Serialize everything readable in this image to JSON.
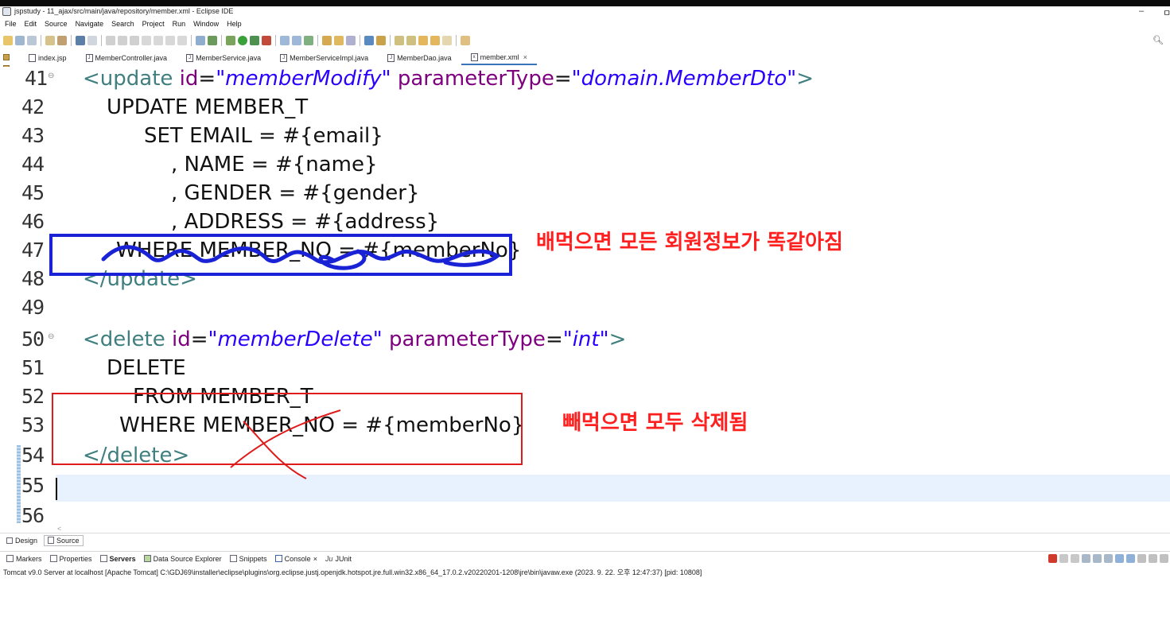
{
  "window": {
    "title": "jspstudy - 11_ajax/src/main/java/repository/member.xml - Eclipse IDE",
    "minimize_glyph": "–",
    "restore_glyph": "ㅁ"
  },
  "menu": [
    "File",
    "Edit",
    "Source",
    "Navigate",
    "Search",
    "Project",
    "Run",
    "Window",
    "Help"
  ],
  "editor_tabs": [
    {
      "label": "index.jsp",
      "icon": "jsp-file-icon"
    },
    {
      "label": "MemberController.java",
      "icon": "java-file-icon"
    },
    {
      "label": "MemberService.java",
      "icon": "java-file-icon"
    },
    {
      "label": "MemberServiceImpl.java",
      "icon": "java-file-icon"
    },
    {
      "label": "MemberDao.java",
      "icon": "java-file-icon"
    },
    {
      "label": "member.xml",
      "icon": "xml-file-icon",
      "active": true,
      "close": "×"
    }
  ],
  "code": {
    "lines": [
      {
        "no": "41",
        "fold": "⊖"
      },
      {
        "no": "42"
      },
      {
        "no": "43"
      },
      {
        "no": "44"
      },
      {
        "no": "45"
      },
      {
        "no": "46"
      },
      {
        "no": "47"
      },
      {
        "no": "48"
      },
      {
        "no": "49"
      },
      {
        "no": "50",
        "fold": "⊖"
      },
      {
        "no": "51"
      },
      {
        "no": "52"
      },
      {
        "no": "53"
      },
      {
        "no": "54"
      },
      {
        "no": "55"
      },
      {
        "no": "56"
      }
    ],
    "l41": {
      "open": "<update ",
      "a1": "id",
      "eq1": "=",
      "v1": "\"memberModify\"",
      "a2": " parameterType",
      "eq2": "=",
      "v2": "\"domain.MemberDto\"",
      "close": ">"
    },
    "l42": "UPDATE MEMBER_T",
    "l43": "SET EMAIL = #{email}",
    "l44": ", NAME = #{name}",
    "l45": ", GENDER = #{gender}",
    "l46": ", ADDRESS = #{address}",
    "l47": "WHERE MEMBER_NO = #{memberNo}",
    "l48": "</update>",
    "l50": {
      "open": "<delete ",
      "a1": "id",
      "eq1": "=",
      "v1": "\"memberDelete\"",
      "a2": " parameterType",
      "eq2": "=",
      "v2": "\"int\"",
      "close": ">"
    },
    "l51": "DELETE",
    "l52": "FROM MEMBER_T",
    "l53": "WHERE MEMBER_NO = #{memberNo}",
    "l54": "</delete>"
  },
  "annotations": {
    "update_note": "배먹으면 모든 회원정보가 똑같아짐",
    "delete_note": "빼먹으면 모두 삭제됨",
    "blue_color": "#1a22d6",
    "red_color": "#e01b1b"
  },
  "bottom_tabs": {
    "design": "Design",
    "source": "Source"
  },
  "views": [
    {
      "label": "Markers",
      "icon": "markers-icon"
    },
    {
      "label": "Properties",
      "icon": "properties-icon"
    },
    {
      "label": "Servers",
      "icon": "servers-icon",
      "active": true
    },
    {
      "label": "Data Source Explorer",
      "icon": "datasource-icon"
    },
    {
      "label": "Snippets",
      "icon": "snippets-icon"
    },
    {
      "label": "Console",
      "icon": "console-icon",
      "close": "×"
    },
    {
      "label": "JUnit",
      "icon": "junit-icon",
      "prefix": "Ju"
    }
  ],
  "console": {
    "text": "Tomcat v9.0 Server at localhost [Apache Tomcat] C:\\GDJ69\\installer\\eclipse\\plugins\\org.eclipse.justj.openjdk.hotspot.jre.full.win32.x86_64_17.0.2.v20220201-1208\\jre\\bin\\javaw.exe  (2023. 9. 22. 오후 12:47:37) [pid: 10808]"
  }
}
